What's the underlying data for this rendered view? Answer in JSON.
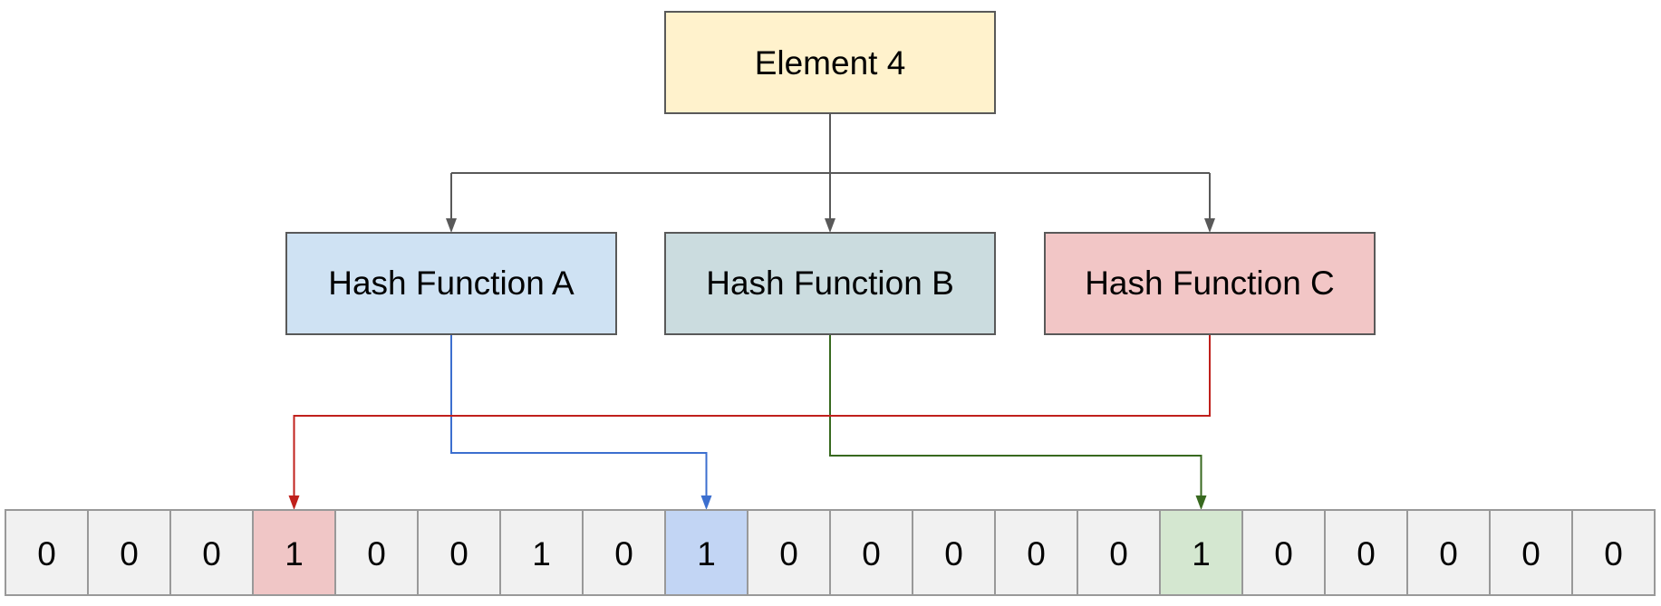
{
  "element": {
    "label": "Element 4",
    "fill": "#fff2cc"
  },
  "hash_functions": [
    {
      "label": "Hash Function A",
      "fill": "#cfe2f3",
      "arrow_color": "#3c6fcf",
      "target_index": 8
    },
    {
      "label": "Hash Function B",
      "fill": "#cbdcdf",
      "arrow_color": "#38691f",
      "target_index": 14
    },
    {
      "label": "Hash Function C",
      "fill": "#f2c6c6",
      "arrow_color": "#c0201c",
      "target_index": 3
    }
  ],
  "bit_array": {
    "values": [
      "0",
      "0",
      "0",
      "1",
      "0",
      "0",
      "1",
      "0",
      "1",
      "0",
      "0",
      "0",
      "0",
      "0",
      "1",
      "0",
      "0",
      "0",
      "0",
      "0"
    ],
    "default_fill": "#f1f1f1",
    "highlight_fills": {
      "3": "#f0c6c6",
      "8": "#c2d5f4",
      "14": "#d4e7d0"
    }
  },
  "colors": {
    "connector": "#595959",
    "border": "#595959",
    "cell_border": "#999999"
  }
}
